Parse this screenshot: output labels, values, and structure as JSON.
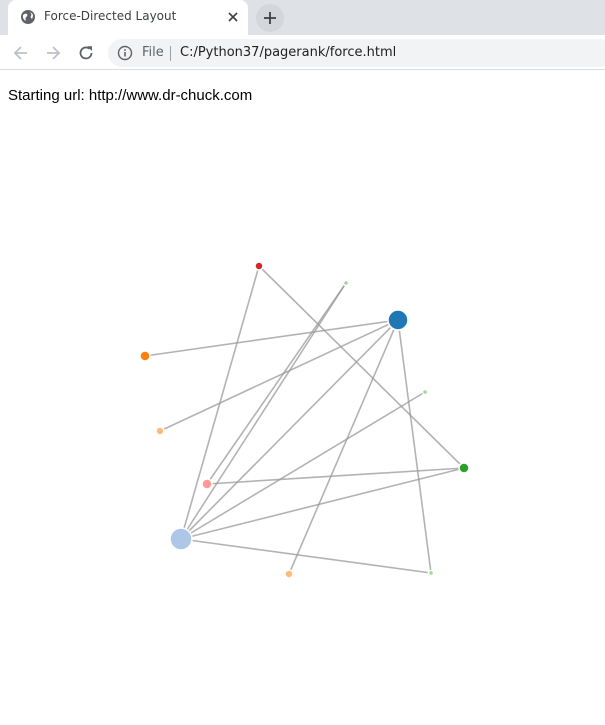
{
  "tab": {
    "title": "Force-Directed Layout",
    "favicon": "globe-icon",
    "close_icon": "close-icon"
  },
  "newtab_icon": "plus-icon",
  "toolbar": {
    "back_icon": "arrow-left-icon",
    "forward_icon": "arrow-right-icon",
    "reload_icon": "reload-icon",
    "info_icon": "info-icon",
    "scheme": "File",
    "url": "C:/Python37/pagerank/force.html"
  },
  "page": {
    "starting_label": "Starting url: http://www.dr-chuck.com"
  },
  "graph": {
    "nodes": [
      {
        "id": "n_red",
        "color": "#d62728"
      },
      {
        "id": "n_lightgreen_top",
        "color": "#98df8a"
      },
      {
        "id": "n_blue",
        "color": "#1f77b4"
      },
      {
        "id": "n_orange",
        "color": "#ff7f0e"
      },
      {
        "id": "n_lightgreen_mid",
        "color": "#98df8a"
      },
      {
        "id": "n_lightorange",
        "color": "#ffbb78"
      },
      {
        "id": "n_green",
        "color": "#2ca02c"
      },
      {
        "id": "n_pink",
        "color": "#ff9896"
      },
      {
        "id": "n_lightblue",
        "color": "#aec7e8"
      },
      {
        "id": "n_lightorange_bottom",
        "color": "#ffbb78"
      },
      {
        "id": "n_lightgreen_bottom",
        "color": "#98df8a"
      }
    ],
    "links": [
      [
        "n_red",
        "n_lightblue"
      ],
      [
        "n_red",
        "n_green"
      ],
      [
        "n_lightgreen_top",
        "n_pink"
      ],
      [
        "n_lightgreen_top",
        "n_lightblue"
      ],
      [
        "n_blue",
        "n_orange"
      ],
      [
        "n_blue",
        "n_lightorange"
      ],
      [
        "n_blue",
        "n_lightblue"
      ],
      [
        "n_blue",
        "n_lightorange_bottom"
      ],
      [
        "n_blue",
        "n_lightgreen_bottom"
      ],
      [
        "n_lightgreen_mid",
        "n_lightblue"
      ],
      [
        "n_green",
        "n_pink"
      ],
      [
        "n_green",
        "n_lightblue"
      ],
      [
        "n_lightblue",
        "n_lightgreen_bottom"
      ]
    ],
    "link_color": "#999999"
  }
}
